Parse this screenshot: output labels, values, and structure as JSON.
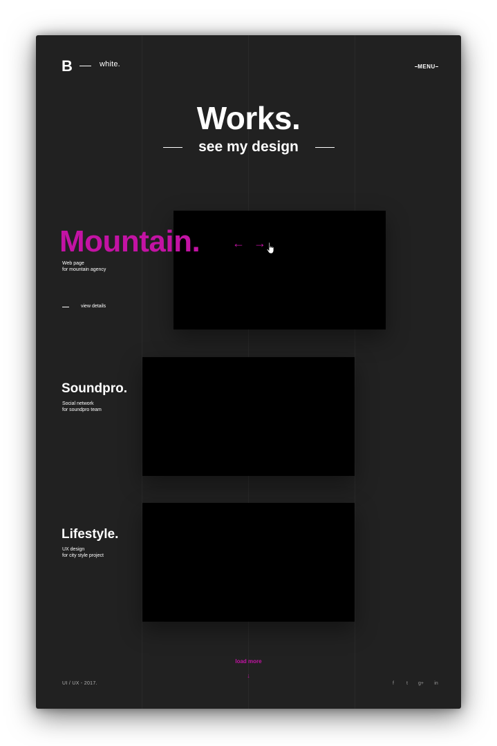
{
  "header": {
    "logo": "B",
    "logo_subtitle": "white.",
    "menu_label": "MENU"
  },
  "hero": {
    "title": "Works.",
    "subtitle": "see my design"
  },
  "projects": [
    {
      "title": "Mountain.",
      "desc_line1": "Web page",
      "desc_line2": "for mountain agency",
      "details_label": "view details"
    },
    {
      "title": "Soundpro.",
      "desc_line1": "Social network",
      "desc_line2": "for soundpro team"
    },
    {
      "title": "Lifestyle.",
      "desc_line1": "UX design",
      "desc_line2": "for city style project"
    }
  ],
  "slider": {
    "prev_icon": "←",
    "next_icon": "→"
  },
  "load_more": {
    "label": "load more",
    "arrow": "↓"
  },
  "footer": {
    "text": "UI / UX  - 2017.",
    "social": [
      {
        "name": "facebook-icon",
        "glyph": "f"
      },
      {
        "name": "twitter-icon",
        "glyph": "t"
      },
      {
        "name": "google-plus-icon",
        "glyph": "g+"
      },
      {
        "name": "linkedin-icon",
        "glyph": "in"
      }
    ]
  },
  "colors": {
    "background": "#212121",
    "accent": "#c313a4",
    "image_placeholder": "#000000",
    "text": "#ffffff"
  }
}
